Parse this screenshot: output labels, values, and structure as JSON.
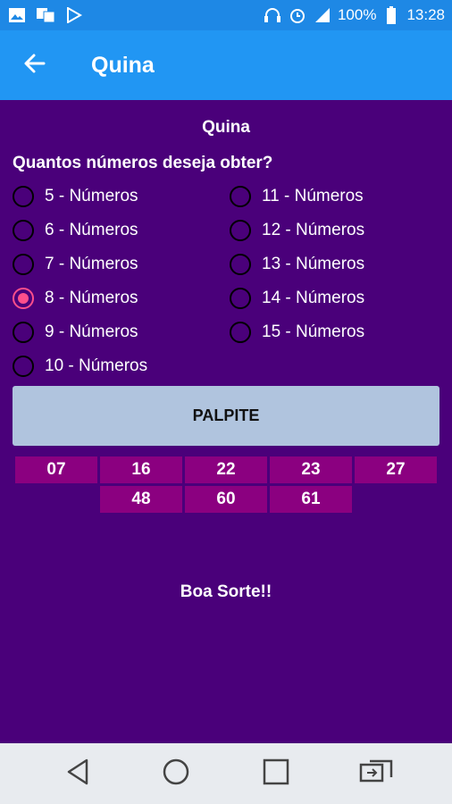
{
  "status_bar": {
    "battery": "100%",
    "time": "13:28",
    "icons": [
      "gallery-icon",
      "translate-icon",
      "play-store-icon",
      "headset-icon",
      "alarm-icon",
      "signal-icon",
      "battery-icon"
    ]
  },
  "app_bar": {
    "title": "Quina"
  },
  "main": {
    "section_title": "Quina",
    "question": "Quantos números deseja obter?",
    "options": [
      "5 - Números",
      "6 - Números",
      "7 - Números",
      "8 - Números",
      "9 - Números",
      "10 - Números",
      "11 - Números",
      "12 - Números",
      "13 - Números",
      "14 - Números",
      "15 - Números"
    ],
    "selected_option": "8 - Números",
    "button_label": "PALPITE",
    "results": [
      "07",
      "16",
      "22",
      "23",
      "27",
      "48",
      "60",
      "61"
    ],
    "footer_text": "Boa Sorte!!"
  },
  "colors": {
    "status_bar": "#1e88e5",
    "app_bar": "#2196f3",
    "background": "#4a007a",
    "result_cell": "#8b0080",
    "button": "#b0c4de",
    "radio_checked": "#ff4f8b"
  }
}
